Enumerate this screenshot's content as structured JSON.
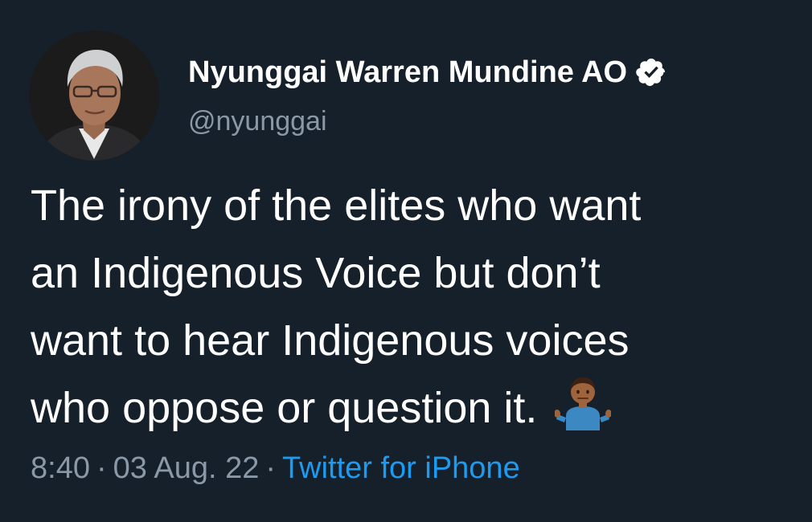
{
  "author": {
    "display_name": "Nyunggai Warren Mundine AO",
    "handle": "@nyunggai",
    "verified": true,
    "avatar_icon": "profile-photo"
  },
  "tweet": {
    "lines": [
      "The irony of the elites who want",
      "an Indigenous Voice but don’t",
      "want to hear Indigenous voices",
      "who oppose or question it."
    ],
    "emoji": "man-shrugging-medium-dark-skin-tone"
  },
  "meta": {
    "time": "8:40",
    "separator": "·",
    "date": "03 Aug. 22",
    "source": "Twitter for iPhone"
  },
  "colors": {
    "background": "#15202b",
    "text": "#ffffff",
    "secondary": "#8b98a5",
    "accent": "#1d9bf0"
  }
}
